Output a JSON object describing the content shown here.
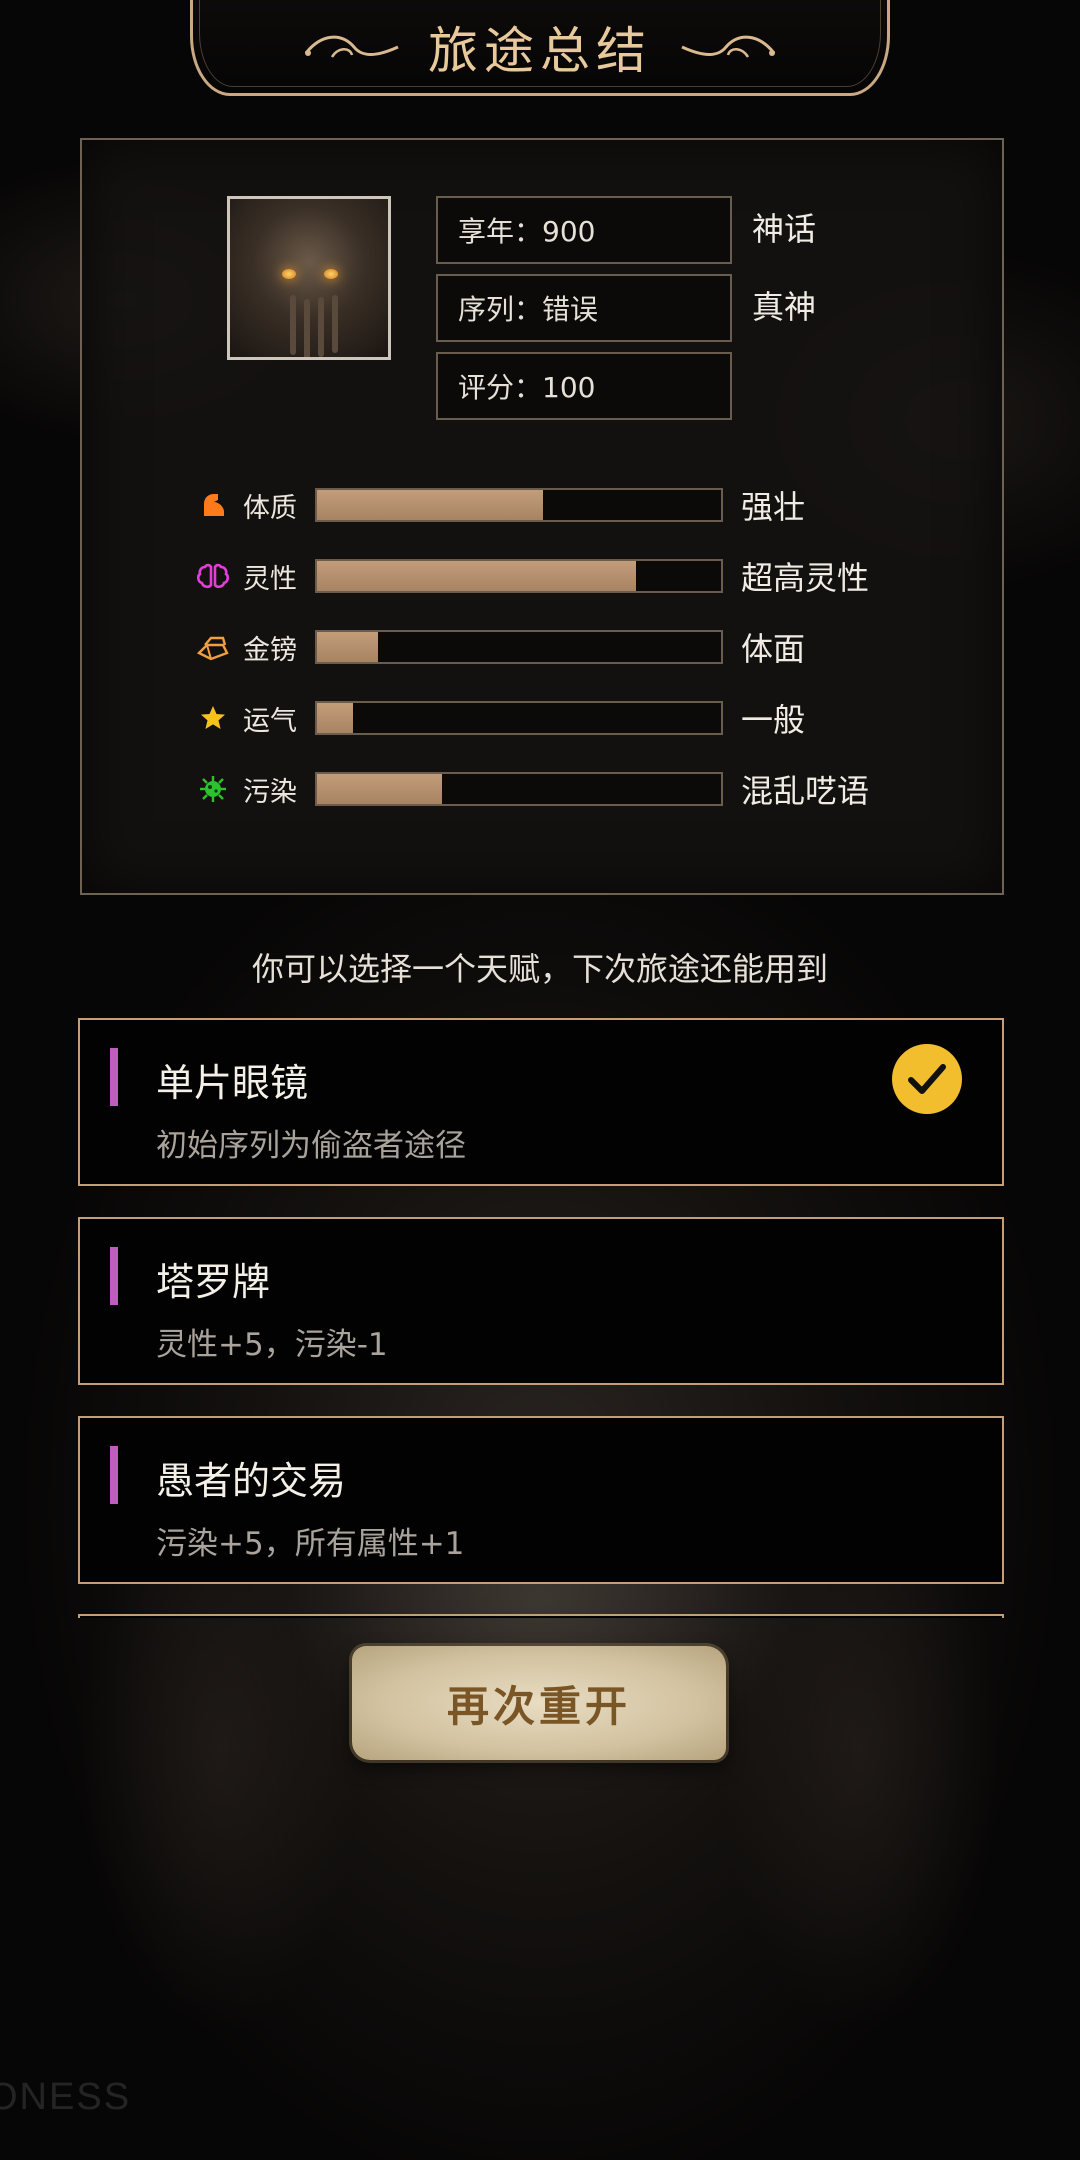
{
  "header": {
    "title": "旅途总结"
  },
  "character": {
    "portrait": "eldritch-portrait",
    "info": [
      {
        "label": "享年：900",
        "tag": "神话"
      },
      {
        "label": "序列：错误",
        "tag": "真神"
      },
      {
        "label": "评分：100",
        "tag": ""
      }
    ]
  },
  "stats": [
    {
      "label": "体质",
      "desc": "强壮",
      "fill": 0.56,
      "icon": "arm-icon",
      "icon_color": "#ff7a1a"
    },
    {
      "label": "灵性",
      "desc": "超高灵性",
      "fill": 0.79,
      "icon": "brain-icon",
      "icon_color": "#e33fd6"
    },
    {
      "label": "金镑",
      "desc": "体面",
      "fill": 0.15,
      "icon": "gold-bars-icon",
      "icon_color": "#f0a040"
    },
    {
      "label": "运气",
      "desc": "一般",
      "fill": 0.09,
      "icon": "star-icon",
      "icon_color": "#f7c21c"
    },
    {
      "label": "污染",
      "desc": "混乱呓语",
      "fill": 0.31,
      "icon": "virus-icon",
      "icon_color": "#2ec22e"
    }
  ],
  "prompt": "你可以选择一个天赋，下次旅途还能用到",
  "talents": [
    {
      "name": "单片眼镜",
      "desc": "初始序列为偷盗者途径",
      "selected": true
    },
    {
      "name": "塔罗牌",
      "desc": "灵性+5，污染-1",
      "selected": false
    },
    {
      "name": "愚者的交易",
      "desc": "污染+5，所有属性+1",
      "selected": false
    }
  ],
  "restart_button": {
    "label": "再次重开"
  },
  "watermark": "ONESS",
  "colors": {
    "accent_gold": "#e8c99b",
    "card_border": "#c49e76",
    "bar_fill": "#b8916e",
    "talent_accent": "#c05cc0",
    "check_badge": "#f2be2e"
  }
}
